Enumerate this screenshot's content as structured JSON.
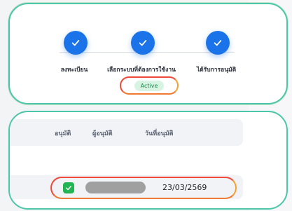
{
  "stepper": {
    "steps": [
      {
        "label": "ลงทะเบียน",
        "status": "completed",
        "icon": "check-icon"
      },
      {
        "label": "เลือกระบบที่ต้องการใช้งาน",
        "status": "completed",
        "icon": "check-icon"
      },
      {
        "label": "ได้รับการอนุมัติ",
        "status": "completed",
        "icon": "check-icon"
      }
    ],
    "status_badge": "Active"
  },
  "table": {
    "headers": {
      "approval": "อนุมัติ",
      "approver": "ผู้อนุมัติ",
      "approved_date": "วันที่อนุมัติ"
    },
    "rows": [
      {
        "approved": true,
        "approver": "",
        "approved_date": "23/03/2569"
      }
    ]
  },
  "colors": {
    "step_blue": "#1a73e8",
    "badge_bg": "#d7f3e2",
    "badge_text": "#1f8a4d",
    "highlight_ring": "#ee4a3a",
    "card_outline": "#4cc6a8",
    "check_green": "#22b455"
  }
}
